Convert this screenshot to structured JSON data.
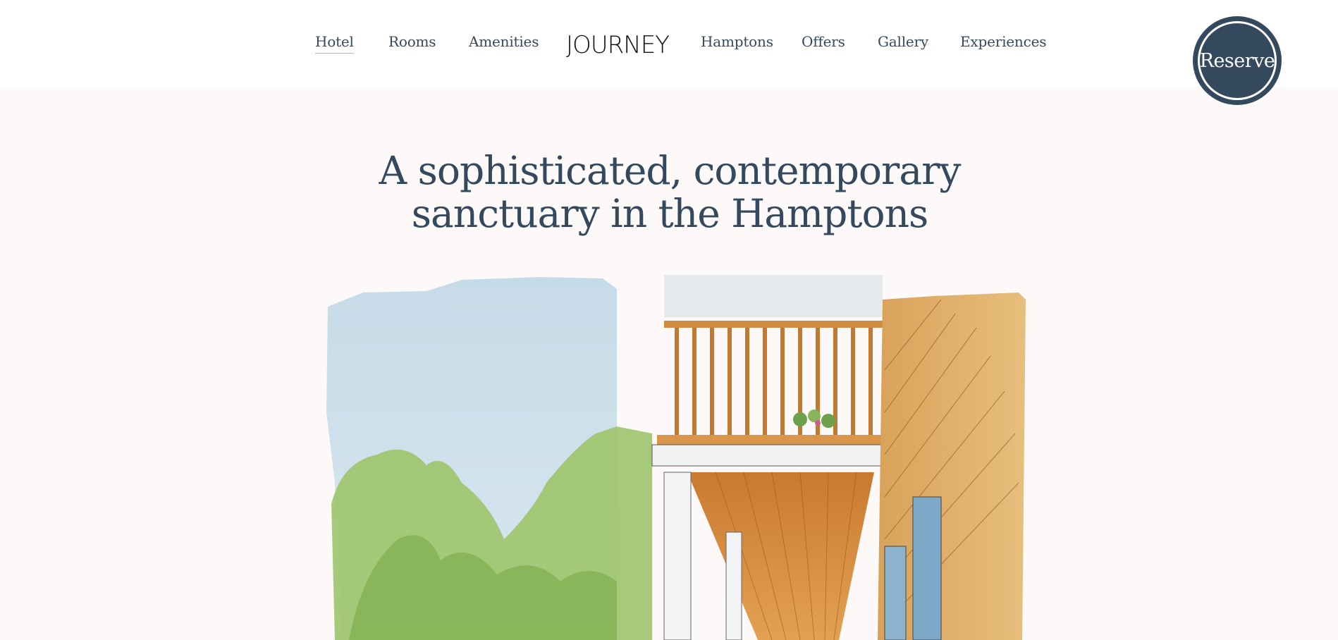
{
  "nav": {
    "left_items": [
      {
        "label": "Hotel",
        "active": true
      },
      {
        "label": "Rooms"
      },
      {
        "label": "Amenities"
      }
    ],
    "logo": "JOURNEY",
    "right_items": [
      {
        "label": "Hamptons"
      },
      {
        "label": "Offers"
      },
      {
        "label": "Gallery"
      },
      {
        "label": "Experiences"
      }
    ]
  },
  "reserve_button": {
    "label": "Reserve"
  },
  "hero": {
    "headline_line1": "A sophisticated, contemporary",
    "headline_line2": "sanctuary in the Hamptons"
  },
  "colors": {
    "primary": "#34495e",
    "page_bg": "#fcf9f8",
    "header_bg": "#ffffff",
    "active_underline": "#d3a6a0"
  }
}
